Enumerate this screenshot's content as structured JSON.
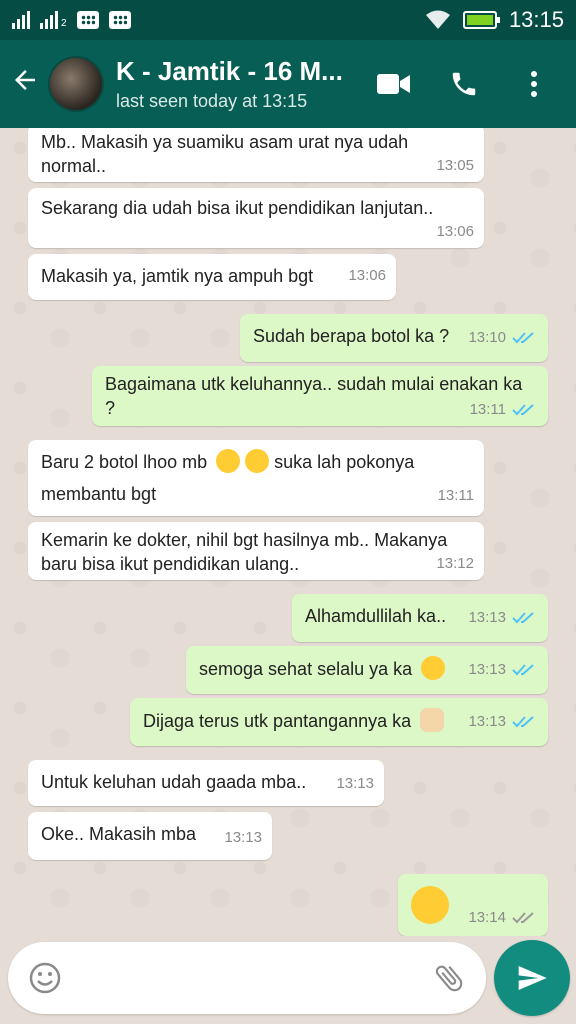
{
  "status_bar": {
    "time": "13:15",
    "sim2_label": "2"
  },
  "header": {
    "back_icon": "arrow-left-icon",
    "title": "K - Jamtik - 16 M...",
    "subtitle": "last seen today at 13:15",
    "video_icon": "video-call-icon",
    "phone_icon": "voice-call-icon",
    "menu_icon": "more-vert-icon"
  },
  "messages": [
    {
      "dir": "in",
      "text": "Mb.. Makasih ya suamiku asam urat nya udah normal..",
      "time": "13:05"
    },
    {
      "dir": "in",
      "text": "Sekarang dia udah bisa ikut pendidikan lanjutan..",
      "time": "13:06"
    },
    {
      "dir": "in",
      "text": "Makasih ya, jamtik nya ampuh bgt",
      "time": "13:06"
    },
    {
      "dir": "out",
      "text": "Sudah berapa botol ka ?",
      "time": "13:10",
      "status": "read"
    },
    {
      "dir": "out",
      "text": "Bagaimana utk keluhannya.. sudah mulai enakan ka ?",
      "time": "13:11",
      "status": "read"
    },
    {
      "dir": "in",
      "text": "Baru 2 botol lhoo mb",
      "text2": "suka lah pokonya membantu bgt",
      "time": "13:11",
      "emojis": [
        "grinning-face-emoji",
        "heart-eyes-emoji"
      ]
    },
    {
      "dir": "in",
      "text": "Kemarin ke dokter, nihil bgt hasilnya mb.. Makanya baru bisa ikut pendidikan ulang..",
      "time": "13:12"
    },
    {
      "dir": "out",
      "text": "Alhamdullilah ka..",
      "time": "13:13",
      "status": "read"
    },
    {
      "dir": "out",
      "text": "semoga sehat selalu ya ka",
      "time": "13:13",
      "status": "read",
      "emojis": [
        "hugging-face-emoji"
      ]
    },
    {
      "dir": "out",
      "text": "Dijaga terus utk pantangannya ka",
      "time": "13:13",
      "status": "read",
      "emojis": [
        "folded-hands-emoji"
      ]
    },
    {
      "dir": "in",
      "text": "Untuk keluhan udah gaada mba..",
      "time": "13:13"
    },
    {
      "dir": "in",
      "text": "Oke.. Makasih mba",
      "time": "13:13"
    },
    {
      "dir": "out",
      "text": "",
      "time": "13:14",
      "status": "delivered",
      "emojis": [
        "winking-face-emoji"
      ]
    }
  ],
  "input": {
    "placeholder": "",
    "emoji_icon": "smiley-icon",
    "attach_icon": "paperclip-icon",
    "send_icon": "send-icon"
  },
  "colors": {
    "header": "#075e54",
    "statusbar": "#054d44",
    "out_bubble": "#dcf8c6",
    "in_bubble": "#ffffff",
    "read_ticks": "#4fc3f7",
    "send_button": "#128c7e"
  }
}
